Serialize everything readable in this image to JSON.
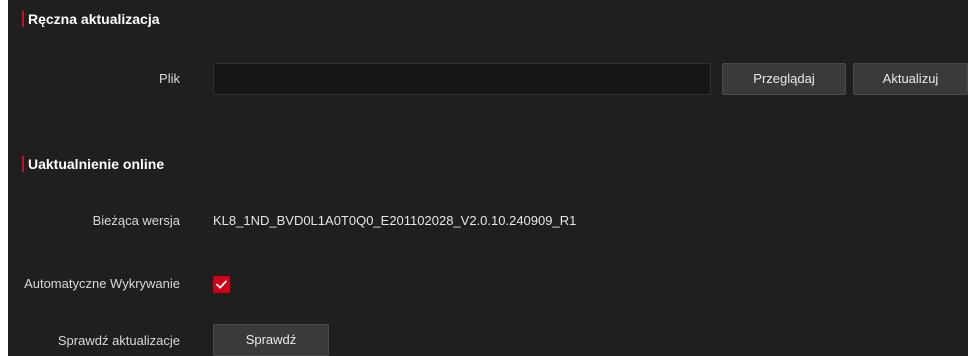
{
  "manual_update": {
    "title": "Ręczna aktualizacja",
    "file_label": "Plik",
    "file_value": "",
    "browse_label": "Przeglądaj",
    "update_label": "Aktualizuj"
  },
  "online_update": {
    "title": "Uaktualnienie online",
    "current_version_label": "Bieżąca wersja",
    "current_version_value": "KL8_1ND_BVD0L1A0T0Q0_E201102028_V2.0.10.240909_R1",
    "auto_detect_label": "Automatyczne Wykrywanie",
    "auto_detect_checked": true,
    "check_label": "Sprawdź aktualizacje",
    "check_button_label": "Sprawdź"
  },
  "colors": {
    "background": "#1f1f1f",
    "accent": "#d0021b",
    "button": "#3a3a3a"
  },
  "icons": {
    "checkbox": "check-icon"
  }
}
